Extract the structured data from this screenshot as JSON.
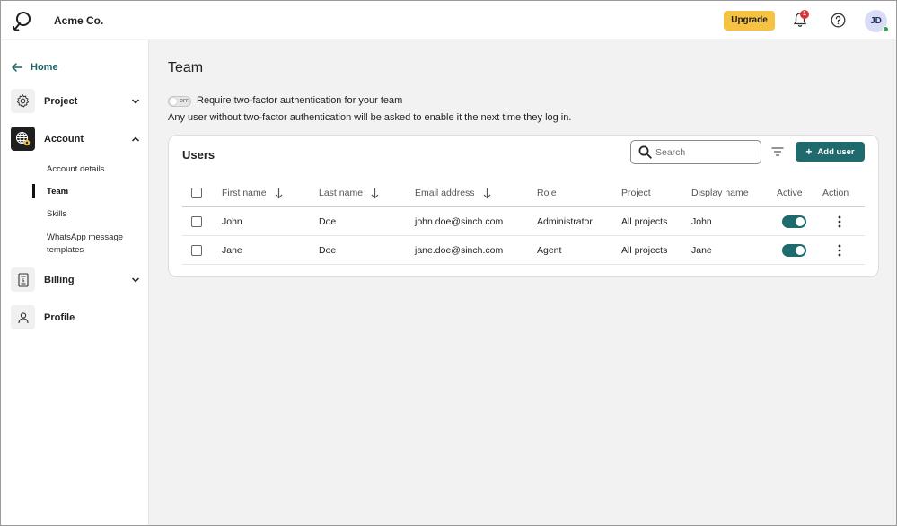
{
  "header": {
    "company": "Acme Co.",
    "upgrade_label": "Upgrade",
    "notification_count": "1",
    "avatar_initials": "JD"
  },
  "sidebar": {
    "home_label": "Home",
    "project_label": "Project",
    "account_label": "Account",
    "account_items": [
      "Account details",
      "Team",
      "Skills",
      "WhatsApp message templates"
    ],
    "billing_label": "Billing",
    "profile_label": "Profile"
  },
  "main": {
    "title": "Team",
    "toggle_state": "OFF",
    "tfa_label": "Require two-factor authentication for your team",
    "tfa_note": "Any user without two-factor authentication will be asked to enable it the next time they log in."
  },
  "users": {
    "title": "Users",
    "search_placeholder": "Search",
    "add_user_label": "Add user",
    "columns": [
      "First name",
      "Last name",
      "Email address",
      "Role",
      "Project",
      "Display name",
      "Active",
      "Action"
    ],
    "rows": [
      {
        "first": "John",
        "last": "Doe",
        "email": "john.doe@sinch.com",
        "role": "Administrator",
        "project": "All projects",
        "display": "John",
        "active": true
      },
      {
        "first": "Jane",
        "last": "Doe",
        "email": "jane.doe@sinch.com",
        "role": "Agent",
        "project": "All projects",
        "display": "Jane",
        "active": true
      }
    ]
  },
  "colors": {
    "accent": "#1f6a6d",
    "upgrade": "#f5c242",
    "badge": "#e0313a"
  }
}
